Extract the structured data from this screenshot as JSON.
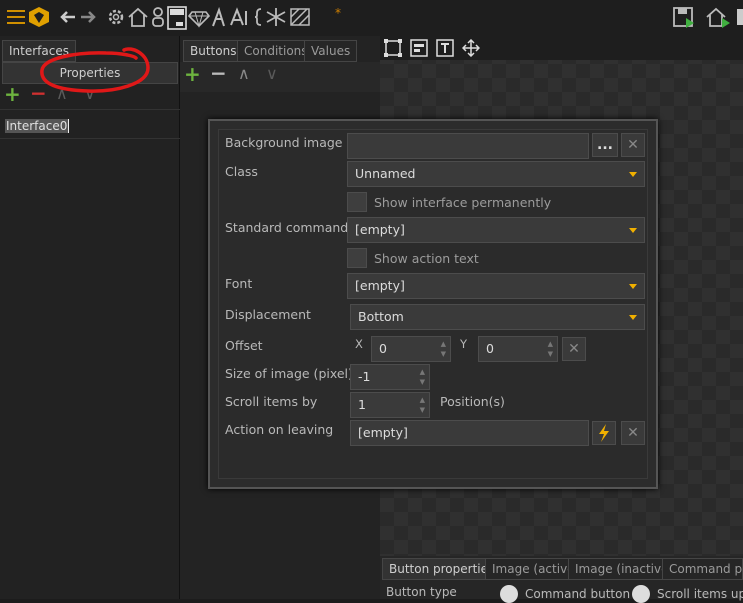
{
  "toolbar": {
    "modified_marker": "*"
  },
  "left_panel": {
    "tab_interfaces": "Interfaces",
    "tab_properties": "Properties",
    "items": [
      "Interface0"
    ]
  },
  "mid_panel": {
    "tabs": [
      "Buttons",
      "Conditions",
      "Values"
    ]
  },
  "dialog": {
    "background_image_label": "Background image",
    "background_image_value": "",
    "browse_label": "...",
    "class_label": "Class",
    "class_value": "Unnamed",
    "show_permanently_label": "Show interface permanently",
    "standard_command_label": "Standard command",
    "standard_command_value": "[empty]",
    "show_action_text_label": "Show action text",
    "font_label": "Font",
    "font_value": "[empty]",
    "displacement_label": "Displacement",
    "displacement_value": "Bottom",
    "offset_label": "Offset",
    "x_label": "X",
    "x_value": "0",
    "y_label": "Y",
    "y_value": "0",
    "size_of_image_label": "Size of image (pixel)",
    "size_of_image_value": "-1",
    "scroll_items_label": "Scroll items by",
    "scroll_items_value": "1",
    "positions_label": "Position(s)",
    "action_on_leaving_label": "Action on leaving",
    "action_on_leaving_value": "[empty]"
  },
  "bottom": {
    "tabs": [
      "Button properties",
      "Image (active)",
      "Image (inactive)",
      "Command pro"
    ],
    "button_type_label": "Button type",
    "radio_command_button": "Command button",
    "radio_scroll_items": "Scroll items up"
  },
  "colors": {
    "accent_orange": "#f0b000",
    "add_green": "#6db33f",
    "remove_red": "#d03030",
    "annotation_red": "#e01818"
  }
}
